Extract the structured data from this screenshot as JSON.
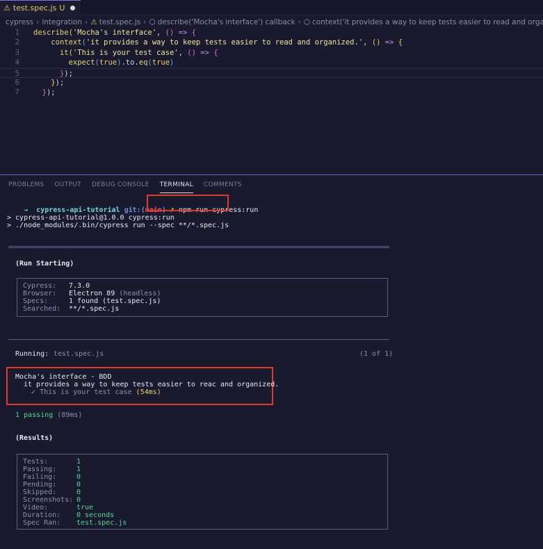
{
  "tab": {
    "filename": "test.spec.js",
    "status": "U"
  },
  "breadcrumb": {
    "items": [
      "cypress",
      "integration",
      "test.spec.js",
      "describe('Mocha's interface') callback",
      "context('it provides a way to keep tests easier to read and organized.') callback"
    ]
  },
  "editor": {
    "lines": [
      {
        "n": "1",
        "parts": [
          [
            "kw-fn",
            "describe"
          ],
          [
            "paren",
            "("
          ],
          [
            "str",
            "'Mocha's interface'"
          ],
          [
            "plain",
            ", "
          ],
          [
            "paren2",
            "()"
          ],
          [
            "plain",
            " "
          ],
          [
            "arrow",
            "=>"
          ],
          [
            "plain",
            " "
          ],
          [
            "paren2",
            "{"
          ]
        ]
      },
      {
        "n": "2",
        "parts": [
          [
            "plain",
            "    "
          ],
          [
            "kw-fn",
            "context"
          ],
          [
            "paren3",
            "("
          ],
          [
            "str",
            "'it provides a way to keep tests easier to read and organized.'"
          ],
          [
            "plain",
            ", "
          ],
          [
            "paren",
            "()"
          ],
          [
            "plain",
            " "
          ],
          [
            "arrow",
            "=>"
          ],
          [
            "plain",
            " "
          ],
          [
            "paren",
            "{"
          ]
        ]
      },
      {
        "n": "3",
        "parts": [
          [
            "plain",
            "      "
          ],
          [
            "kw-fn",
            "it"
          ],
          [
            "paren",
            "("
          ],
          [
            "str",
            "'This is your test case'"
          ],
          [
            "plain",
            ", "
          ],
          [
            "paren2",
            "()"
          ],
          [
            "plain",
            " "
          ],
          [
            "arrow",
            "=>"
          ],
          [
            "plain",
            " "
          ],
          [
            "paren2",
            "{"
          ]
        ]
      },
      {
        "n": "4",
        "parts": [
          [
            "plain",
            "        "
          ],
          [
            "kw-fn",
            "expect"
          ],
          [
            "paren3",
            "("
          ],
          [
            "bool",
            "true"
          ],
          [
            "paren3",
            ")"
          ],
          [
            "plain",
            ".to."
          ],
          [
            "kw-fn",
            "eq"
          ],
          [
            "paren3",
            "("
          ],
          [
            "bool",
            "true"
          ],
          [
            "paren3",
            ")"
          ]
        ]
      },
      {
        "n": "5",
        "parts": [
          [
            "plain",
            "      "
          ],
          [
            "paren2",
            "}"
          ],
          [
            "plain",
            ");"
          ]
        ]
      },
      {
        "n": "6",
        "parts": [
          [
            "plain",
            "    "
          ],
          [
            "paren",
            "}"
          ],
          [
            "plain",
            ");"
          ]
        ]
      },
      {
        "n": "7",
        "parts": [
          [
            "plain",
            "  "
          ],
          [
            "paren2",
            "}"
          ],
          [
            "plain",
            ");"
          ]
        ]
      }
    ]
  },
  "panel_tabs": [
    "PROBLEMS",
    "OUTPUT",
    "DEBUG CONSOLE",
    "TERMINAL",
    "COMMENTS"
  ],
  "terminal": {
    "prompt_arrow": "→",
    "dir": "cypress-api-tutorial",
    "git_label": "git:(",
    "branch": "main",
    "git_close": ")",
    "dirty": "✗",
    "command": "npm run cypress:run",
    "out1": "> cypress-api-tutorial@1.0.0 cypress:run",
    "out2": "> ./node_modules/.bin/cypress run --spec **/*.spec.js",
    "run_starting": "(Run Starting)",
    "info": {
      "cypress_label": "Cypress:",
      "cypress_val": "7.3.0",
      "browser_label": "Browser:",
      "browser_val": "Electron 89",
      "browser_mode": "(headless)",
      "specs_label": "Specs:",
      "specs_val": "1 found (test.spec.js)",
      "searched_label": "Searched:",
      "searched_val": "**/*.spec.js"
    },
    "running_label": "Running:",
    "running_spec": "test.spec.js",
    "running_count": "(1 of 1)",
    "suite": "Mocha's interface - BDD",
    "context": "it provides a way to keep tests easier to reac and organized.",
    "check": "✓",
    "test": "This is your test case",
    "test_time": "(54ms)",
    "passing": "1 passing",
    "passing_time": "(89ms)",
    "results_label": "(Results)",
    "results": [
      {
        "label": "Tests:",
        "value": "1"
      },
      {
        "label": "Passing:",
        "value": "1"
      },
      {
        "label": "Failing:",
        "value": "0"
      },
      {
        "label": "Pending:",
        "value": "0"
      },
      {
        "label": "Skipped:",
        "value": "0"
      },
      {
        "label": "Screenshots:",
        "value": "0"
      },
      {
        "label": "Video:",
        "value": "true"
      },
      {
        "label": "Duration:",
        "value": "0 seconds"
      },
      {
        "label": "Spec Ran:",
        "value": "test.spec.js"
      }
    ]
  }
}
